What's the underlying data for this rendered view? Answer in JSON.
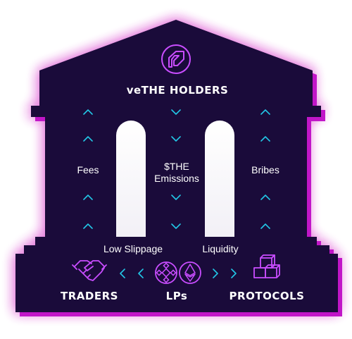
{
  "header": {
    "title": "veTHE HOLDERS"
  },
  "flows": {
    "fees": "Fees",
    "emissions": "$THE Emissions",
    "bribes": "Bribes",
    "low_slippage": "Low Slippage",
    "liquidity": "Liquidity"
  },
  "groups": {
    "traders": "TRADERS",
    "lps": "LPs",
    "protocols": "PROTOCOLS"
  },
  "colors": {
    "background": "#ffffff",
    "building_fill": "#1a0b3a",
    "outline_magenta": "#e81fd2",
    "glow": "#ff2bd6",
    "accent_cyan": "#22c7e6",
    "icon_pink": "#c94dff",
    "text": "#ffffff"
  },
  "icons": {
    "top": "thena-logo-icon",
    "traders": "handshake-icon",
    "lps": [
      "bnb-icon",
      "ethereum-icon"
    ],
    "protocols": "stacked-cubes-icon"
  }
}
